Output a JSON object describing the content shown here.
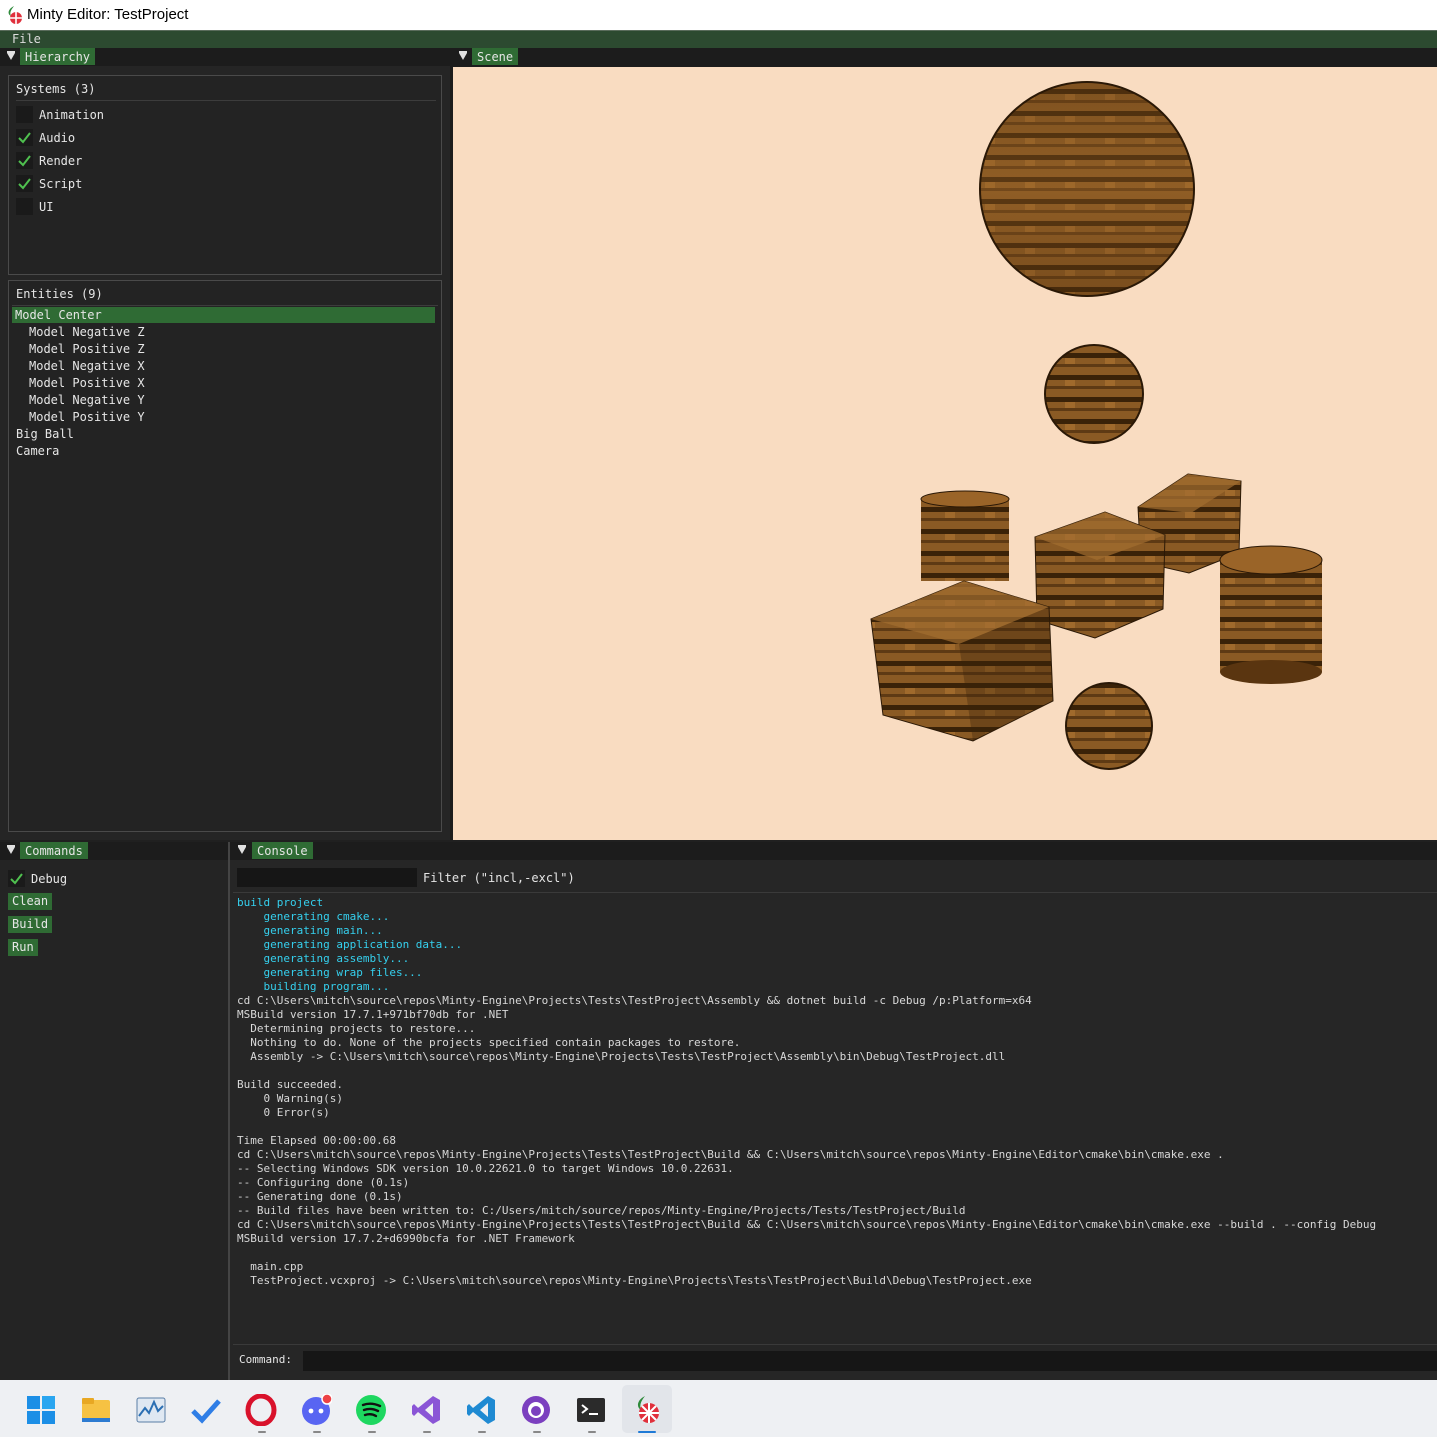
{
  "window": {
    "title": "Minty Editor: TestProject"
  },
  "menu": {
    "file": "File"
  },
  "hierarchy": {
    "tab": "Hierarchy",
    "systems_header": "Systems (3)",
    "systems": [
      {
        "label": "Animation",
        "checked": false
      },
      {
        "label": "Audio",
        "checked": true
      },
      {
        "label": "Render",
        "checked": true
      },
      {
        "label": "Script",
        "checked": true
      },
      {
        "label": "UI",
        "checked": false
      }
    ],
    "entities_header": "Entities (9)",
    "entities": [
      {
        "label": "Model Center",
        "selected": true
      },
      {
        "label": "Model Negative Z"
      },
      {
        "label": "Model Positive Z"
      },
      {
        "label": "Model Negative X"
      },
      {
        "label": "Model Positive X"
      },
      {
        "label": "Model Negative Y"
      },
      {
        "label": "Model Positive Y"
      },
      {
        "label": "Big Ball"
      },
      {
        "label": "Camera"
      }
    ]
  },
  "scene": {
    "tab": "Scene",
    "background": "#f9dcc1"
  },
  "commands": {
    "tab": "Commands",
    "debug_label": "Debug",
    "debug_checked": true,
    "clean": "Clean",
    "build": "Build",
    "run": "Run"
  },
  "console": {
    "tab": "Console",
    "filter_label": "Filter (\"incl,-excl\")",
    "filter_value": "",
    "command_label": "Command:",
    "command_value": "",
    "lines": [
      {
        "text": "build project",
        "color": "cyan"
      },
      {
        "text": "    generating cmake...",
        "color": "cyan"
      },
      {
        "text": "    generating main...",
        "color": "cyan"
      },
      {
        "text": "    generating application data...",
        "color": "cyan"
      },
      {
        "text": "    generating assembly...",
        "color": "cyan"
      },
      {
        "text": "    generating wrap files...",
        "color": "cyan"
      },
      {
        "text": "    building program...",
        "color": "cyan"
      },
      {
        "text": "cd C:\\Users\\mitch\\source\\repos\\Minty-Engine\\Projects\\Tests\\TestProject\\Assembly && dotnet build -c Debug /p:Platform=x64",
        "color": "white"
      },
      {
        "text": "MSBuild version 17.7.1+971bf70db for .NET",
        "color": "white"
      },
      {
        "text": "  Determining projects to restore...",
        "color": "white"
      },
      {
        "text": "  Nothing to do. None of the projects specified contain packages to restore.",
        "color": "white"
      },
      {
        "text": "  Assembly -> C:\\Users\\mitch\\source\\repos\\Minty-Engine\\Projects\\Tests\\TestProject\\Assembly\\bin\\Debug\\TestProject.dll",
        "color": "white"
      },
      {
        "text": "",
        "color": "white"
      },
      {
        "text": "Build succeeded.",
        "color": "white"
      },
      {
        "text": "    0 Warning(s)",
        "color": "white"
      },
      {
        "text": "    0 Error(s)",
        "color": "white"
      },
      {
        "text": "",
        "color": "white"
      },
      {
        "text": "Time Elapsed 00:00:00.68",
        "color": "white"
      },
      {
        "text": "cd C:\\Users\\mitch\\source\\repos\\Minty-Engine\\Projects\\Tests\\TestProject\\Build && C:\\Users\\mitch\\source\\repos\\Minty-Engine\\Editor\\cmake\\bin\\cmake.exe .",
        "color": "white"
      },
      {
        "text": "-- Selecting Windows SDK version 10.0.22621.0 to target Windows 10.0.22631.",
        "color": "white"
      },
      {
        "text": "-- Configuring done (0.1s)",
        "color": "white"
      },
      {
        "text": "-- Generating done (0.1s)",
        "color": "white"
      },
      {
        "text": "-- Build files have been written to: C:/Users/mitch/source/repos/Minty-Engine/Projects/Tests/TestProject/Build",
        "color": "white"
      },
      {
        "text": "cd C:\\Users\\mitch\\source\\repos\\Minty-Engine\\Projects\\Tests\\TestProject\\Build && C:\\Users\\mitch\\source\\repos\\Minty-Engine\\Editor\\cmake\\bin\\cmake.exe --build . --config Debug",
        "color": "white"
      },
      {
        "text": "MSBuild version 17.7.2+d6990bcfa for .NET Framework",
        "color": "white"
      },
      {
        "text": "",
        "color": "white"
      },
      {
        "text": "  main.cpp",
        "color": "white"
      },
      {
        "text": "  TestProject.vcxproj -> C:\\Users\\mitch\\source\\repos\\Minty-Engine\\Projects\\Tests\\TestProject\\Build\\Debug\\TestProject.exe",
        "color": "white"
      }
    ]
  },
  "taskbar": {
    "icons": [
      "windows-start-icon",
      "file-explorer-icon",
      "resource-monitor-icon",
      "todo-icon",
      "opera-icon",
      "discord-icon",
      "spotify-icon",
      "visual-studio-icon",
      "vscode-icon",
      "github-desktop-icon",
      "terminal-icon",
      "minty-editor-icon"
    ]
  },
  "colors": {
    "accent": "#2f6b34",
    "console_cyan": "#35d0ee"
  }
}
